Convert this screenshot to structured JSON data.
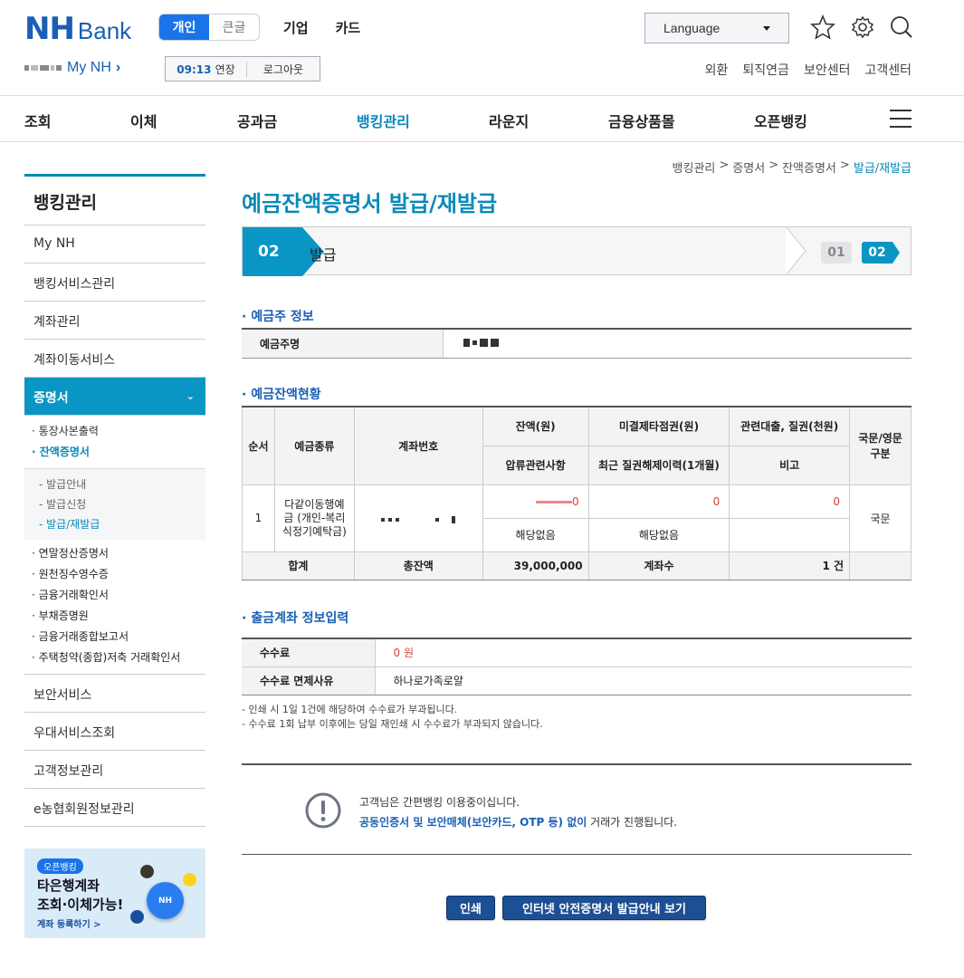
{
  "header": {
    "logo_nh": "NH",
    "logo_bank": "Bank",
    "mode_tabs": [
      "개인",
      "큰글"
    ],
    "top_nav": [
      "기업",
      "카드"
    ],
    "language_label": "Language",
    "my_nh": "My NH",
    "session_time": "09:13",
    "session_extend": "연장",
    "logout": "로그아웃",
    "util_nav": [
      "외환",
      "퇴직연금",
      "보안센터",
      "고객센터"
    ]
  },
  "gnb": [
    "조회",
    "이체",
    "공과금",
    "뱅킹관리",
    "라운지",
    "금융상품몰",
    "오픈뱅킹"
  ],
  "lnb": {
    "title": "뱅킹관리",
    "top_items": [
      "My NH",
      "뱅킹서비스관리",
      "계좌관리",
      "계좌이동서비스"
    ],
    "active": "증명서",
    "sub_before": [
      "· 통장사본출력",
      "· 잔액증명서"
    ],
    "sub3": [
      "- 발급안내",
      "- 발급신청",
      "- 발급/재발급"
    ],
    "sub_after": [
      "· 연말정산증명서",
      "· 원천징수영수증",
      "· 금융거래확인서",
      "· 부채증명원",
      "· 금융거래종합보고서",
      "· 주택청약(종합)저축 거래확인서"
    ],
    "bottom_items": [
      "보안서비스",
      "우대서비스조회",
      "고객정보관리",
      "e농협회원정보관리"
    ]
  },
  "banner": {
    "tag": "오픈뱅킹",
    "line1": "타은행계좌",
    "line2": "조회·이체가능!",
    "link": "계좌 등록하기 >",
    "fab": "NH"
  },
  "breadcrumb": [
    "뱅킹관리",
    "증명서",
    "잔액증명서",
    "발급/재발급"
  ],
  "page_title": "예금잔액증명서 발급/재발급",
  "step": {
    "number": "02",
    "label": "발급",
    "chips": [
      "01",
      "02"
    ]
  },
  "owner": {
    "section": "예금주 정보",
    "label": "예금주명"
  },
  "balance": {
    "section": "예금잔액현황",
    "headers": {
      "no": "순서",
      "type": "예금종류",
      "account": "계좌번호",
      "balance": "잔액(원)",
      "unsettled": "미결제타점권(원)",
      "loan": "관련대출, 질권(천원)",
      "lang": "국문/영문 구분",
      "seizure": "압류관련사항",
      "pledge_release": "최근 질권해제이력(1개월)",
      "remark": "비고"
    },
    "row": {
      "no": "1",
      "type": "다같이동행예금 (개인-복리식정기예탁금)",
      "balance_suffix": "0",
      "unsettled": "0",
      "loan": "0",
      "lang": "국문",
      "seizure": "해당없음",
      "pledge_release": "해당없음",
      "remark": ""
    },
    "total": {
      "label": "합계",
      "total_label": "총잔액",
      "total_value": "39,000,000",
      "count_label": "계좌수",
      "count_value": "1 건"
    }
  },
  "fee": {
    "section": "출금계좌 정보입력",
    "fee_label": "수수료",
    "fee_value": "0 원",
    "exempt_label": "수수료 면제사유",
    "exempt_value": "하나로가족로얄"
  },
  "notes": [
    "- 인쇄 시 1일 1건에 해당하여 수수료가 부과됩니다.",
    "- 수수료 1회 납부 이후에는 당일 재인쇄 시 수수료가 부과되지 않습니다."
  ],
  "info": {
    "line1": "고객님은 간편뱅킹 이용중이십니다.",
    "line2_bold": "공동인증서 및 보안매체(보안카드, OTP 등) 없이",
    "line2_rest": " 거래가 진행됩니다."
  },
  "buttons": {
    "print": "인쇄",
    "guide": "인터넷 안전증명서 발급안내 보기"
  },
  "colors": {
    "brand": "#1a5fb4",
    "accent": "#0a96c4",
    "alert": "#e04030",
    "button": "#1d4f94"
  }
}
